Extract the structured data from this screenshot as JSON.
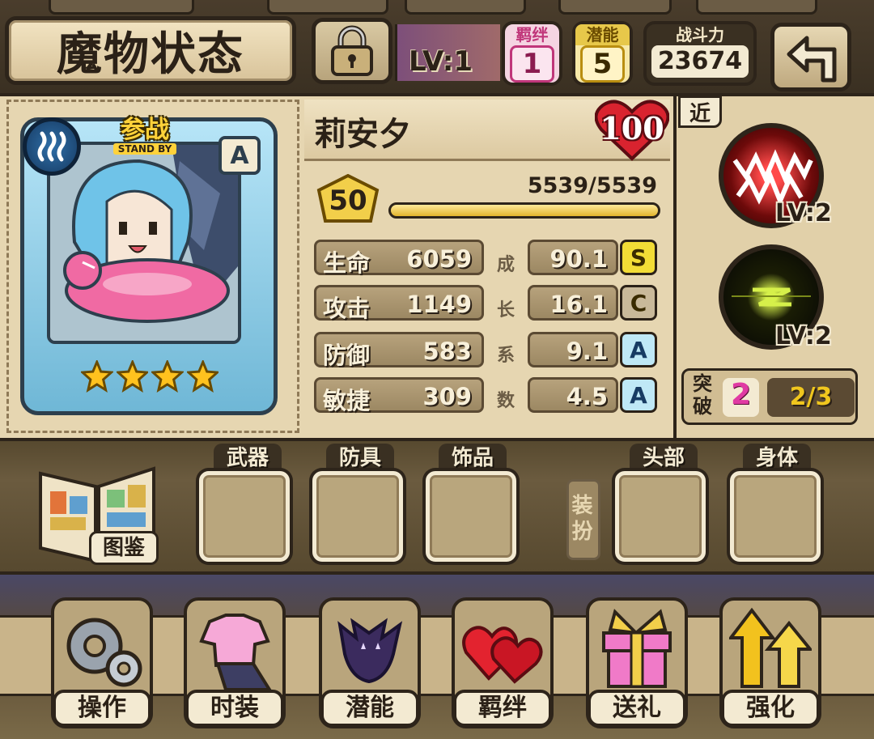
{
  "header": {
    "title": "魔物状态",
    "lock_icon": "padlock-icon",
    "lv_label": "LV:1",
    "bond": {
      "label": "羁绊",
      "value": "1"
    },
    "potential": {
      "label": "潜能",
      "value": "5"
    },
    "power": {
      "label": "战斗力",
      "value": "23674"
    },
    "back_icon": "back-arrow-icon"
  },
  "card": {
    "standby_main": "参战",
    "standby_sub": "STAND BY",
    "element_icon": "water-steam-icon",
    "rank": "A",
    "stars": 4
  },
  "monster": {
    "name": "莉安夕",
    "affection": "100",
    "level": "50",
    "exp_text": "5539/5539",
    "exp_fraction": 1.0
  },
  "stats": [
    {
      "name": "生命",
      "value": "6059",
      "growth": "90.1",
      "grade": "S"
    },
    {
      "name": "攻击",
      "value": "1149",
      "growth": "16.1",
      "grade": "C"
    },
    {
      "name": "防御",
      "value": "583",
      "growth": "9.1",
      "grade": "A"
    },
    {
      "name": "敏捷",
      "value": "309",
      "growth": "4.5",
      "grade": "A"
    }
  ],
  "growth_label": "成长系数",
  "skills": {
    "range": "近",
    "items": [
      {
        "icon": "fanged-maw-icon",
        "level": "LV:2"
      },
      {
        "icon": "dark-vortex-icon",
        "level": "LV:2"
      }
    ],
    "breakthrough_label": "突破",
    "breakthrough_count": "2",
    "breakthrough_progress": "2/3"
  },
  "equipment": {
    "codex_label": "图鉴",
    "dress_label": "装扮",
    "slots": [
      "武器",
      "防具",
      "饰品",
      "头部",
      "身体"
    ]
  },
  "menu": [
    {
      "label": "操作",
      "icon": "gear-icon"
    },
    {
      "label": "时装",
      "icon": "outfit-icon"
    },
    {
      "label": "潜能",
      "icon": "shadow-demon-icon"
    },
    {
      "label": "羁绊",
      "icon": "hearts-icon"
    },
    {
      "label": "送礼",
      "icon": "gift-icon"
    },
    {
      "label": "强化",
      "icon": "upgrade-arrows-icon"
    }
  ],
  "colors": {
    "panel": "#e6d6b1",
    "dark_border": "#2d241a",
    "grade_s": "#f2dc36",
    "grade_c": "#c9b99a",
    "grade_a": "#bfe8f6",
    "breakthrough_pink": "#e03aa3",
    "exp_gold": "#e3b52c"
  }
}
